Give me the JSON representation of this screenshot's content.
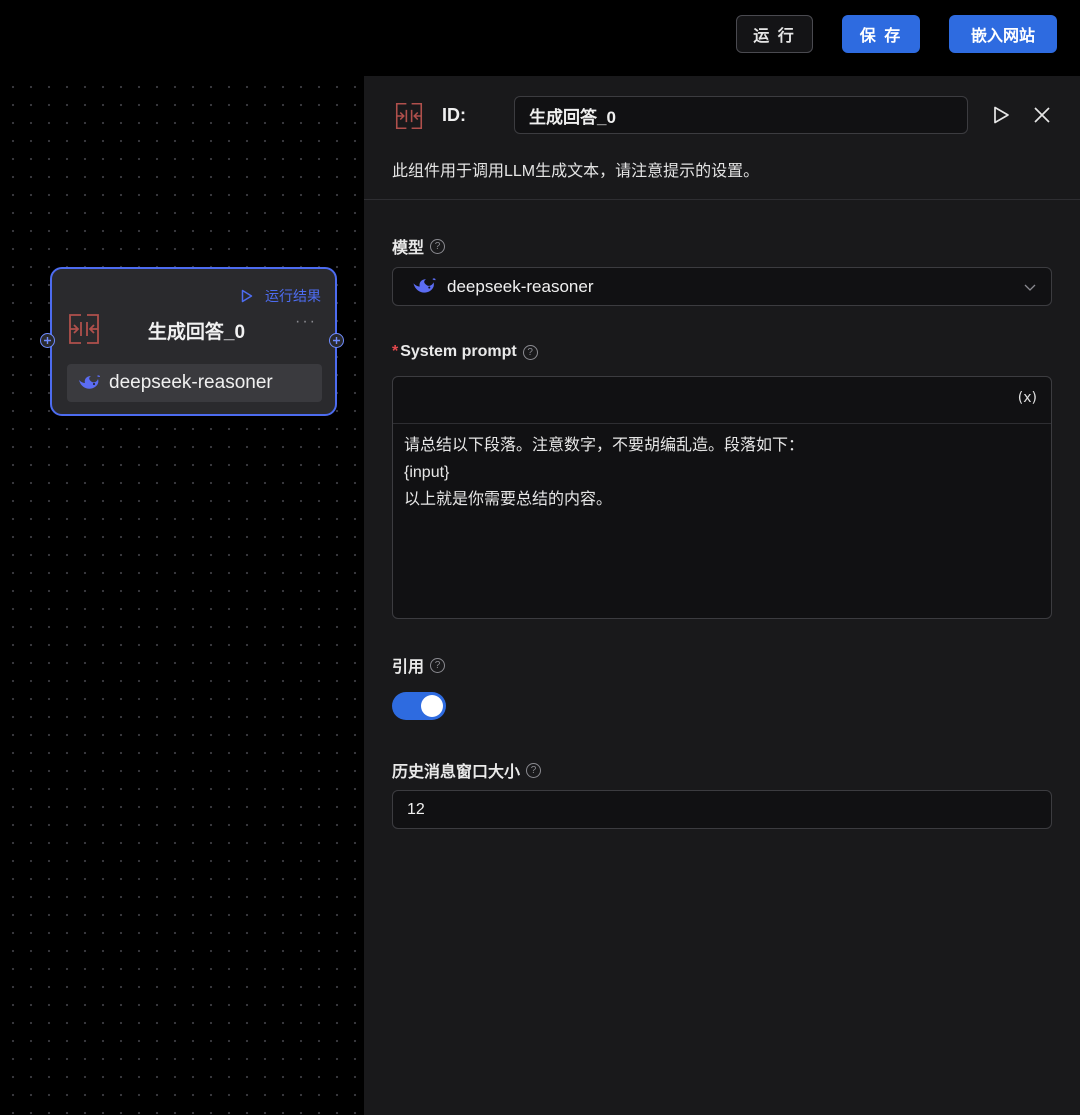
{
  "toolbar": {
    "run_label": "运 行",
    "save_label": "保 存",
    "embed_label": "嵌入网站"
  },
  "node": {
    "run_result_label": "运行结果",
    "title": "生成回答_0",
    "more": "···",
    "model": "deepseek-reasoner"
  },
  "panel": {
    "id_label": "ID:",
    "id_value": "生成回答_0",
    "description": "此组件用于调用LLM生成文本，请注意提示的设置。",
    "model_label": "模型",
    "model_value": "deepseek-reasoner",
    "system_prompt_label": "System prompt",
    "required_mark": "*",
    "variable_button": "(x)",
    "prompt_lines": [
      "请总结以下段落。注意数字，不要胡编乱造。段落如下：",
      "{input}",
      "以上就是你需要总结的内容。"
    ],
    "citation_label": "引用",
    "citation_enabled": true,
    "history_label": "历史消息窗口大小",
    "history_value": "12",
    "help_glyph": "?"
  },
  "colors": {
    "accent": "#2e6be0",
    "node_border": "#4d6cf0",
    "component_icon": "#d9534f",
    "required": "#e5484d"
  },
  "icons": [
    "play-icon",
    "close-icon",
    "component-icon",
    "deepseek-whale-icon",
    "chevron-down-icon",
    "help-icon",
    "variable-icon",
    "plus-handle-icon",
    "more-icon"
  ]
}
